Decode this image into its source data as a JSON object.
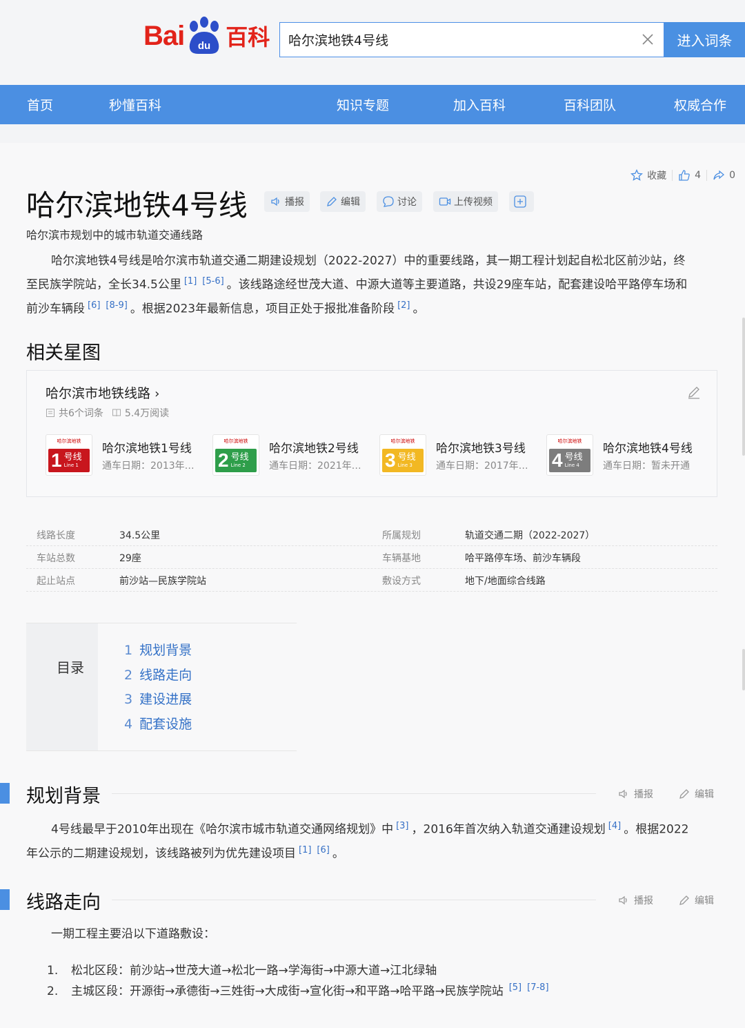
{
  "header": {
    "logo_bai": "Bai",
    "logo_du": "du",
    "logo_baike": "百科",
    "search_value": "哈尔滨地铁4号线",
    "enter_label": "进入词条"
  },
  "nav": {
    "items": [
      "首页",
      "秒懂百科",
      "知识专题",
      "加入百科",
      "百科团队",
      "权威合作"
    ]
  },
  "actions": {
    "favorite": "收藏",
    "likes": "4",
    "shares": "0"
  },
  "article": {
    "title": "哈尔滨地铁4号线",
    "tools": [
      "播报",
      "编辑",
      "讨论",
      "上传视频"
    ],
    "subtitle": "哈尔滨市规划中的城市轨道交通线路",
    "summary": {
      "line1": "哈尔滨地铁4号线是哈尔滨市轨道交通二期建设规划（2022-2027）中的重要线路，其一期工程计划起自松北区前沙站，终",
      "line2a": "至民族学院站，全长34.5公里",
      "ref1": "[1]",
      "ref2": "[5-6]",
      "line2b": "。该线路途经世茂大道、中源大道等主要道路，共设29座车站，配套建设哈平路停车场和",
      "line3a": "前沙车辆段",
      "ref3": "[6]",
      "ref4": "[8-9]",
      "line3b": "。根据2023年最新信息，项目正处于报批准备阶段",
      "ref5": "[2]",
      "line3c": "。"
    }
  },
  "starmap": {
    "heading": "相关星图",
    "title": "哈尔滨市地铁线路",
    "entries": "共6个词条",
    "reads": "5.4万阅读",
    "lines": [
      {
        "num": "1",
        "hx": "号线",
        "en": "Line 1",
        "name": "哈尔滨地铁1号线",
        "date": "通车日期：2013年…",
        "color": "#c8161d"
      },
      {
        "num": "2",
        "hx": "号线",
        "en": "Line 2",
        "name": "哈尔滨地铁2号线",
        "date": "通车日期：2021年…",
        "color": "#2e9e4a"
      },
      {
        "num": "3",
        "hx": "号线",
        "en": "Line 3",
        "name": "哈尔滨地铁3号线",
        "date": "通车日期：2017年…",
        "color": "#f2b823"
      },
      {
        "num": "4",
        "hx": "号线",
        "en": "Line 4",
        "name": "哈尔滨地铁4号线",
        "date": "通车日期：暂未开通",
        "color": "#7d7d7d"
      }
    ],
    "badge_top": "哈尔滨地铁"
  },
  "infobox": [
    {
      "k1": "线路长度",
      "v1": "34.5公里",
      "k2": "所属规划",
      "v2": "轨道交通二期（2022-2027）"
    },
    {
      "k1": "车站总数",
      "v1": "29座",
      "k2": "车辆基地",
      "v2": "哈平路停车场、前沙车辆段"
    },
    {
      "k1": "起止站点",
      "v1": "前沙站—民族学院站",
      "k2": "敷设方式",
      "v2": "地下/地面综合线路"
    }
  ],
  "toc": {
    "label": "目录",
    "items": [
      {
        "no": "1",
        "text": "规划背景"
      },
      {
        "no": "2",
        "text": "线路走向"
      },
      {
        "no": "3",
        "text": "建设进展"
      },
      {
        "no": "4",
        "text": "配套设施"
      }
    ]
  },
  "section1": {
    "title": "规划背景",
    "broadcast": "播报",
    "edit": "编辑",
    "p1a": "4号线最早于2010年出现在《哈尔滨市城市轨道交通网络规划》中",
    "ref1": "[3]",
    "p1b": "，2016年首次纳入轨道交通建设规划",
    "ref2": "[4]",
    "p1c": "。根据2022",
    "p2a": "年公示的二期建设规划，该线路被列为优先建设项目",
    "ref3": "[1]",
    "ref4": "[6]",
    "p2b": "。"
  },
  "section2": {
    "title": "线路走向",
    "broadcast": "播报",
    "edit": "编辑",
    "intro": "一期工程主要沿以下道路敷设：",
    "items": [
      {
        "idx": "1.",
        "text": "松北区段：前沙站→世茂大道→松北一路→学海街→中源大道→江北绿轴"
      },
      {
        "idx": "2.",
        "text": "主城区段：开源街→承德街→三姓街→大成街→宣化街→和平路→哈平路→民族学院站",
        "ref1": "[5]",
        "ref2": "[7-8]"
      }
    ]
  }
}
